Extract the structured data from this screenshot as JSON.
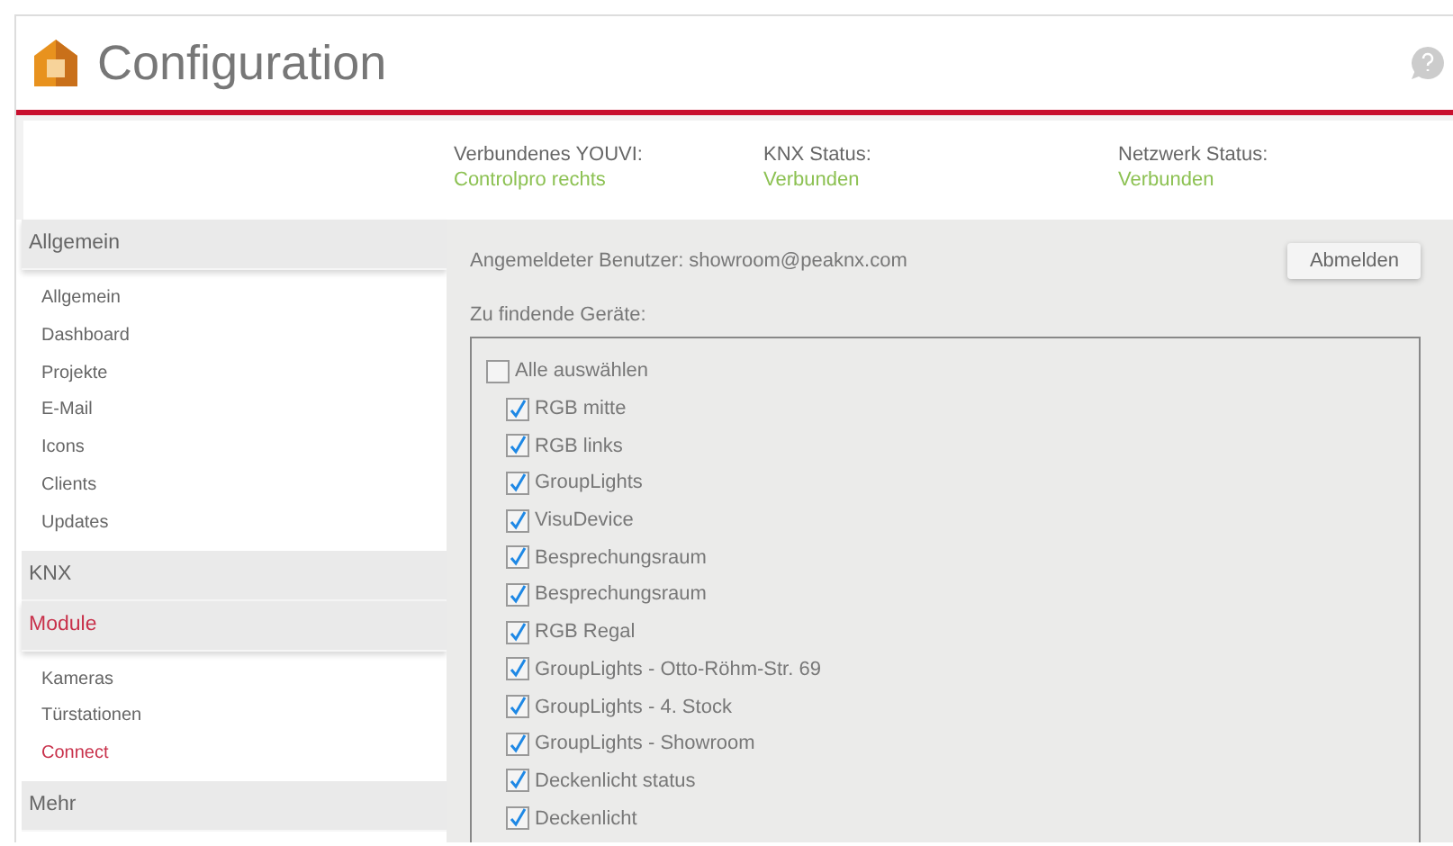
{
  "header": {
    "title": "Configuration"
  },
  "status": [
    {
      "label": "Verbundenes YOUVI:",
      "value": "Controlpro rechts"
    },
    {
      "label": "KNX Status:",
      "value": "Verbunden"
    },
    {
      "label": "Netzwerk Status:",
      "value": "Verbunden"
    }
  ],
  "sidebar": [
    {
      "label": "Allgemein",
      "selected": false,
      "expanded": true,
      "items": [
        {
          "label": "Allgemein",
          "selected": false
        },
        {
          "label": "Dashboard",
          "selected": false
        },
        {
          "label": "Projekte",
          "selected": false
        },
        {
          "label": "E-Mail",
          "selected": false
        },
        {
          "label": "Icons",
          "selected": false
        },
        {
          "label": "Clients",
          "selected": false
        },
        {
          "label": "Updates",
          "selected": false
        }
      ]
    },
    {
      "label": "KNX",
      "selected": false,
      "expanded": false
    },
    {
      "label": "Module",
      "selected": true,
      "expanded": true,
      "items": [
        {
          "label": "Kameras",
          "selected": false
        },
        {
          "label": "Türstationen",
          "selected": false
        },
        {
          "label": "Connect",
          "selected": true
        }
      ]
    },
    {
      "label": "Mehr",
      "selected": false,
      "expanded": false
    }
  ],
  "user_line": "Angemeldeter Benutzer: showroom@peaknx.com",
  "logout_button": "Abmelden",
  "devices_label": "Zu findende Geräte:",
  "select_all": {
    "label": "Alle auswählen",
    "checked": false
  },
  "devices": [
    {
      "label": "RGB mitte",
      "checked": true
    },
    {
      "label": "RGB links",
      "checked": true
    },
    {
      "label": "GroupLights",
      "checked": true
    },
    {
      "label": "VisuDevice",
      "checked": true
    },
    {
      "label": "Besprechungsraum",
      "checked": true
    },
    {
      "label": "Besprechungsraum",
      "checked": true
    },
    {
      "label": "RGB Regal",
      "checked": true
    },
    {
      "label": "GroupLights - Otto-Röhm-Str. 69",
      "checked": true
    },
    {
      "label": "GroupLights - 4. Stock",
      "checked": true
    },
    {
      "label": "GroupLights - Showroom",
      "checked": true
    },
    {
      "label": "Deckenlicht status",
      "checked": true
    },
    {
      "label": "Deckenlicht",
      "checked": true
    }
  ]
}
